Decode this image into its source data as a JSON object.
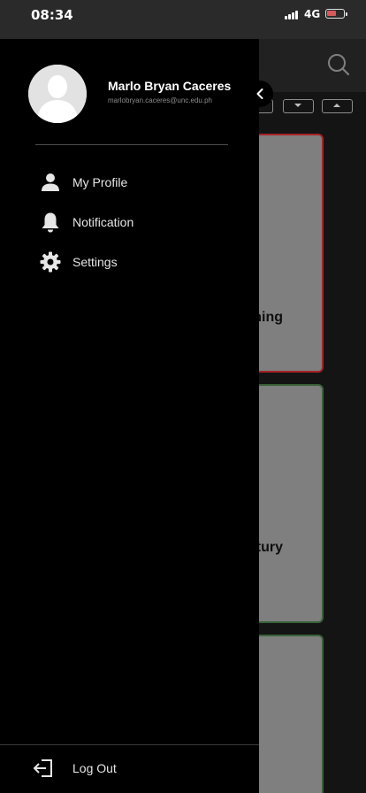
{
  "status_bar": {
    "time": "08:34",
    "network": "4G",
    "battery_level": 0.6,
    "battery_color": "#d65a5a"
  },
  "background": {
    "cards": [
      {
        "title": "ning",
        "border_color": "#b3262b"
      },
      {
        "title": "ntury",
        "border_color": "#3f6b3f"
      },
      {
        "title": "",
        "border_color": "#3f6b3f"
      }
    ]
  },
  "drawer": {
    "user": {
      "name": "Marlo Bryan Caceres",
      "email": "marlobryan.caceres@unc.edu.ph"
    },
    "menu": [
      {
        "label": "My Profile",
        "icon": "person-icon"
      },
      {
        "label": "Notification",
        "icon": "bell-icon"
      },
      {
        "label": "Settings",
        "icon": "gear-icon"
      }
    ],
    "logout_label": "Log Out"
  }
}
